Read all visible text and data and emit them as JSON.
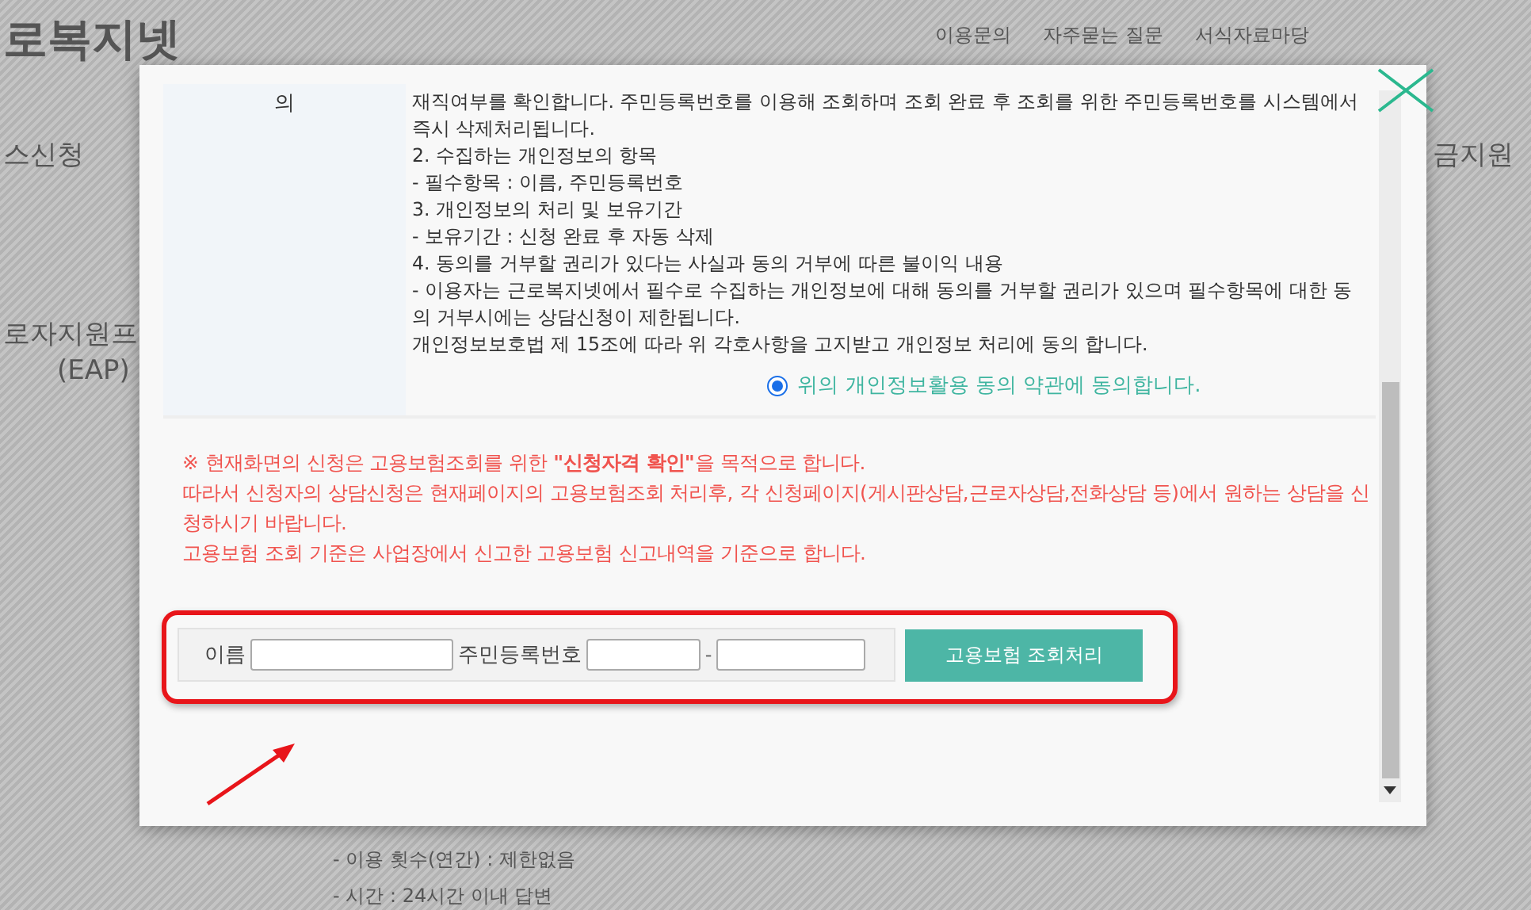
{
  "page": {
    "logo": "로복지넷",
    "nav": [
      "이용문의",
      "자주묻는 질문",
      "서식자료마당"
    ],
    "left_menu": [
      "스신청",
      "로자지원프",
      "(EAP)"
    ],
    "right_menu": [
      "금지원"
    ],
    "bottom_lines": [
      "- 이용 횟수(연간) : 제한없음",
      "- 시간 : 24시간 이내 답변"
    ]
  },
  "modal": {
    "consent_table": {
      "label": "의",
      "lines": [
        "재직여부를 확인합니다. 주민등록번호를 이용해 조회하며 조회 완료 후 조회를 위한 주민등록번호를 시스템에서 즉시 삭제처리됩니다.",
        "2. 수집하는 개인정보의 항목",
        "- 필수항목 : 이름, 주민등록번호",
        "3. 개인정보의 처리 및 보유기간",
        "- 보유기간 : 신청 완료 후 자동 삭제",
        "4. 동의를 거부할 권리가 있다는 사실과 동의 거부에 따른 불이익 내용",
        "- 이용자는 근로복지넷에서 필수로 수집하는 개인정보에 대해 동의를 거부할 권리가 있으며 필수항목에 대한 동의 거부시에는 상담신청이 제한됩니다.",
        "개인정보보호법 제 15조에 따라 위 각호사항을 고지받고 개인정보 처리에 동의 합니다."
      ],
      "agree": {
        "label": "위의 개인정보활용 동의 약관에 동의합니다.",
        "selected": true
      }
    },
    "notice": [
      "※ 현재화면의 신청은 고용보험조회를 위한 **\"신청자격 확인\"**을 목적으로 합니다.",
      "따라서 신청자의 상담신청은 현재페이지의 고용보험조회 처리후, 각 신청페이지(게시판상담,근로자상담,전화상담 등)에서 원하는 상담을 신청하시기 바랍니다.",
      "고용보험 조회 기준은 사업장에서 신고한 고용보험 신고내역을 기준으로 합니다."
    ],
    "form": {
      "name_label": "이름",
      "id_label": "주민등록번호",
      "separator": "-",
      "button": "고용보험 조회처리"
    }
  }
}
